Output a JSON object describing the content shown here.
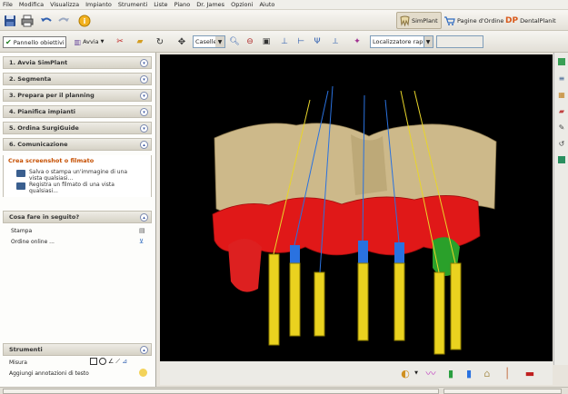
{
  "menubar": {
    "items": [
      "File",
      "Modifica",
      "Visualizza",
      "Impianto",
      "Strumenti",
      "Liste",
      "Piano",
      "Dr. James",
      "Opzioni",
      "Aiuto"
    ]
  },
  "toolbar1": {
    "icons": [
      "save-icon",
      "print-icon",
      "undo-icon",
      "redo-icon",
      "help-icon"
    ],
    "tabs": [
      {
        "label": "SimPlant",
        "active": true
      },
      {
        "label": "Pagine d'Ordine",
        "active": false
      },
      {
        "label": "DentalPlanit",
        "active": false
      }
    ]
  },
  "toolbar2": {
    "panel_checkbox": {
      "label": "Pannello obiettivi",
      "checked": true
    },
    "avvia_label": "Avvia",
    "zoom_select": "Caselle",
    "localizer_select": "Localizzatore rapi",
    "empty_select": ""
  },
  "leftpanel": {
    "sections": [
      {
        "label": "1. Avvia SimPlant",
        "state": "collapsed"
      },
      {
        "label": "2. Segmenta",
        "state": "collapsed"
      },
      {
        "label": "3. Prepara per il planning",
        "state": "collapsed"
      },
      {
        "label": "4. Pianifica impianti",
        "state": "collapsed"
      },
      {
        "label": "5. Ordina SurgiGuide",
        "state": "collapsed"
      },
      {
        "label": "6. Comunicazione",
        "state": "expanded"
      }
    ],
    "comm": {
      "subhead": "Crea screenshot o filmato",
      "item1": "Salva o stampa un'immagine di una vista qualsiasi...",
      "item2": "Registra un filmato di una vista qualsiasi..."
    },
    "next": {
      "title": "Cosa fare in seguito?",
      "stampa": "Stampa",
      "ordine": "Ordine online ..."
    },
    "strumenti": {
      "title": "Strumenti",
      "misura": "Misura",
      "annotazioni": "Aggiungi annotazioni di testo"
    }
  },
  "colors": {
    "accent_orange": "#c64f00",
    "bone": "#cdb98a",
    "gum": "#e01818",
    "implant_yellow": "#ead21f",
    "implant_blue": "#2a72e0",
    "viewport_bg": "#000000"
  }
}
